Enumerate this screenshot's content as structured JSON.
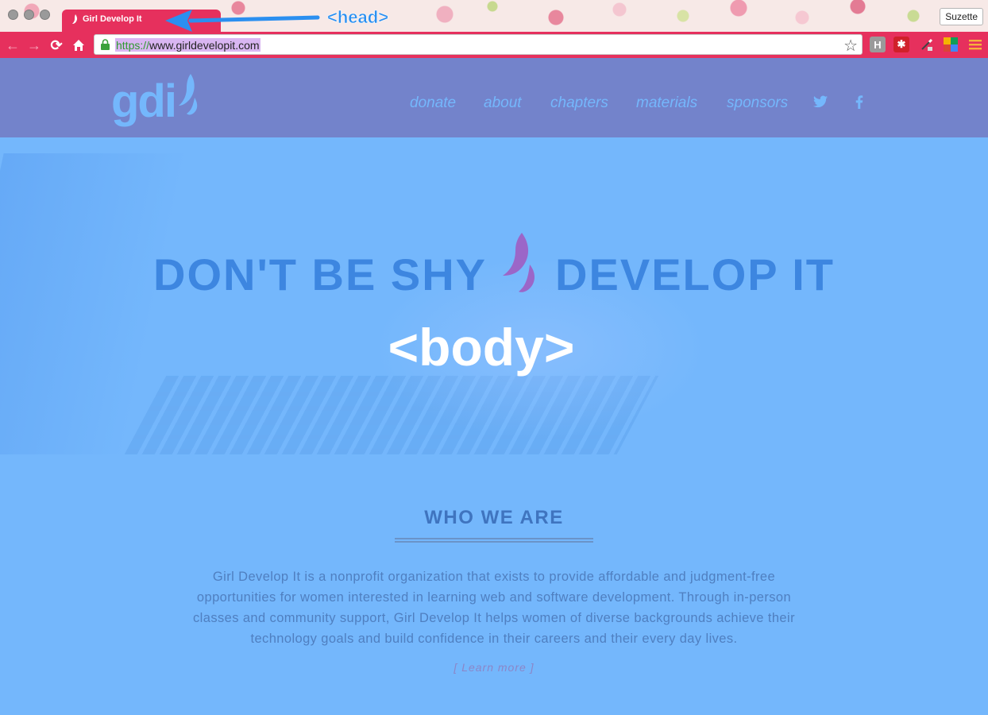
{
  "browser": {
    "tab_title": "Girl Develop It",
    "url_scheme": "https://",
    "url_host": "www.girldevelopit.com",
    "profile_name": "Suzette",
    "extensions": [
      "H",
      "✱"
    ]
  },
  "annotations": {
    "head_label": "<head>",
    "body_label": "<body>"
  },
  "site": {
    "logo_text": "gdi",
    "nav": [
      "donate",
      "about",
      "chapters",
      "materials",
      "sponsors"
    ],
    "social": [
      "twitter-icon",
      "facebook-icon"
    ],
    "hero": {
      "title_left": "DON'T BE SHY",
      "title_right": "DEVELOP IT"
    },
    "who": {
      "title": "WHO WE ARE",
      "text": "Girl Develop It is a nonprofit organization that exists to provide affordable and judgment-free opportunities for women interested in learning web and software development. Through in-person classes and community support, Girl Develop It helps women of diverse backgrounds achieve their technology goals and build confidence in their careers and their every day lives.",
      "learn_more": "[ Learn more ]"
    }
  },
  "colors": {
    "browser_accent": "#e6305d",
    "header_bg": "#7383cb",
    "page_bg": "#74b7fc",
    "logo_drop": "#9b66c8"
  }
}
